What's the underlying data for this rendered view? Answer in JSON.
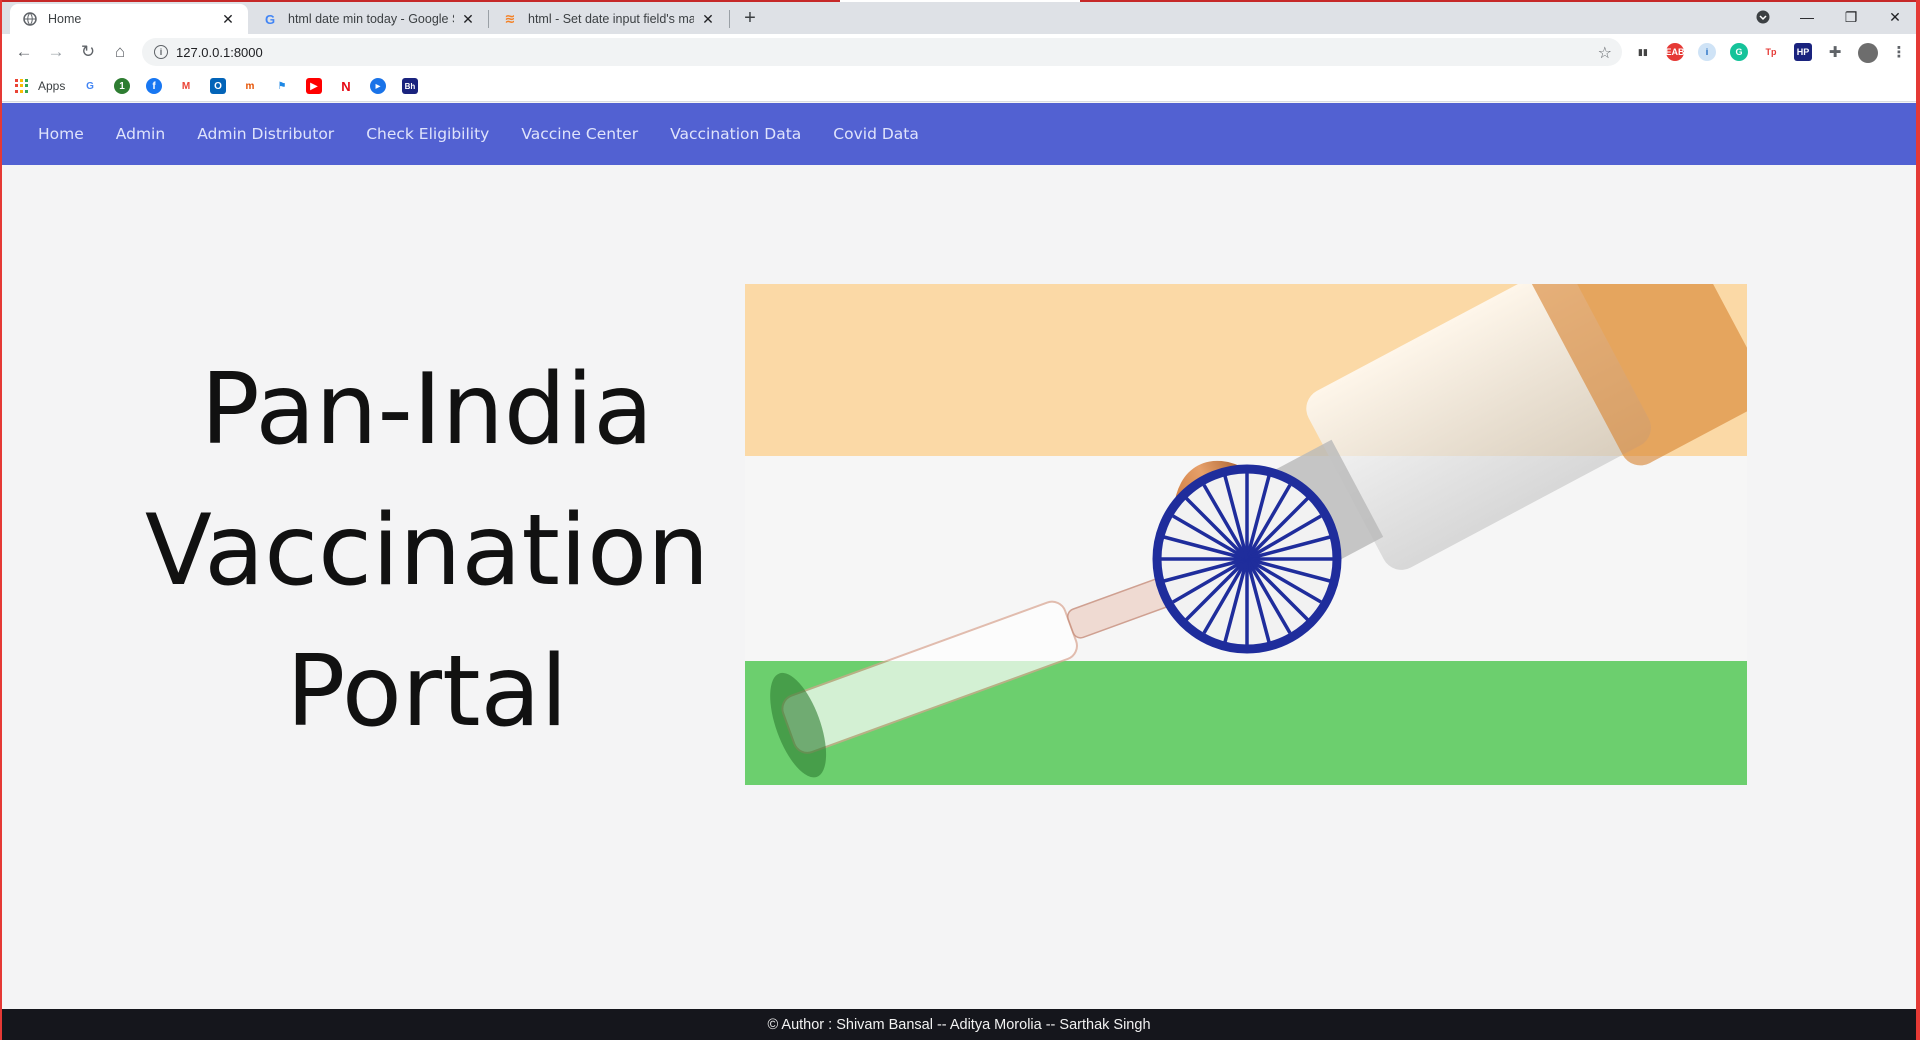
{
  "browser": {
    "tabs": [
      {
        "title": "Home",
        "active": true,
        "favicon": "globe-icon"
      },
      {
        "title": "html date min today - Google Se",
        "active": false,
        "favicon": "google-icon"
      },
      {
        "title": "html - Set date input field's max",
        "active": false,
        "favicon": "stackoverflow-icon"
      }
    ],
    "new_tab": "+",
    "address": "127.0.0.1:8000",
    "bookmarks": {
      "apps_label": "Apps"
    }
  },
  "nav": {
    "items": [
      "Home",
      "Admin",
      "Admin Distributor",
      "Check Eligibility",
      "Vaccine Center",
      "Vaccination Data",
      "Covid Data"
    ]
  },
  "hero": {
    "title_lines": [
      "Pan-India",
      "Vaccination",
      "Portal"
    ]
  },
  "footer": {
    "text": "© Author : Shivam Bansal -- Aditya Morolia -- Sarthak Singh"
  },
  "colors": {
    "navbar": "#5261d2",
    "footer": "#15161c",
    "saffron": "#fbd9a6",
    "green": "#6ccf6e",
    "chakra": "#1f2d9c"
  }
}
